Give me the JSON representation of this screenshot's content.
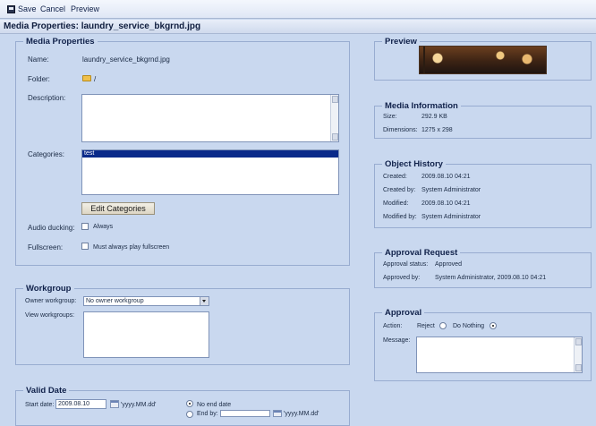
{
  "toolbar": {
    "save": "Save",
    "cancel": "Cancel",
    "preview": "Preview"
  },
  "title": "Media Properties: laundry_service_bkgrnd.jpg",
  "media_properties": {
    "legend": "Media Properties",
    "name_label": "Name:",
    "name_value": "laundry_service_bkgrnd.jpg",
    "folder_label": "Folder:",
    "folder_value": "/",
    "description_label": "Description:",
    "description_value": "",
    "categories_label": "Categories:",
    "categories_items": [
      "test"
    ],
    "edit_categories": "Edit Categories",
    "audio_ducking_label": "Audio ducking:",
    "audio_ducking_option": "Always",
    "fullscreen_label": "Fullscreen:",
    "fullscreen_option": "Must always play fullscreen"
  },
  "workgroup": {
    "legend": "Workgroup",
    "owner_label": "Owner workgroup:",
    "owner_value": "No owner workgroup",
    "view_label": "View workgroups:"
  },
  "valid_date": {
    "legend": "Valid Date",
    "start_label": "Start date:",
    "start_value": "2009.08.10",
    "start_format": "'yyyy.MM.dd'",
    "no_end_label": "No end date",
    "end_by_label": "End by:",
    "end_format": "'yyyy.MM.dd'"
  },
  "preview": {
    "legend": "Preview"
  },
  "media_information": {
    "legend": "Media Information",
    "size_label": "Size:",
    "size_value": "292.9 KB",
    "dimensions_label": "Dimensions:",
    "dimensions_value": "1275 x 298"
  },
  "object_history": {
    "legend": "Object History",
    "created_label": "Created:",
    "created_value": "2009.08.10 04:21",
    "created_by_label": "Created by:",
    "created_by_value": "System Administrator",
    "modified_label": "Modified:",
    "modified_value": "2009.08.10 04:21",
    "modified_by_label": "Modified by:",
    "modified_by_value": "System Administrator"
  },
  "approval_request": {
    "legend": "Approval Request",
    "status_label": "Approval status:",
    "status_value": "Approved",
    "approved_by_label": "Approved by:",
    "approved_by_value": "System Administrator, 2009.08.10 04:21"
  },
  "approval": {
    "legend": "Approval",
    "action_label": "Action:",
    "reject_label": "Reject",
    "do_nothing_label": "Do Nothing",
    "selected_action": "Do Nothing",
    "message_label": "Message:"
  },
  "colors": {
    "background": "#c9d8ef",
    "panel_border": "#98acd0",
    "selection": "#0a2a8a"
  }
}
